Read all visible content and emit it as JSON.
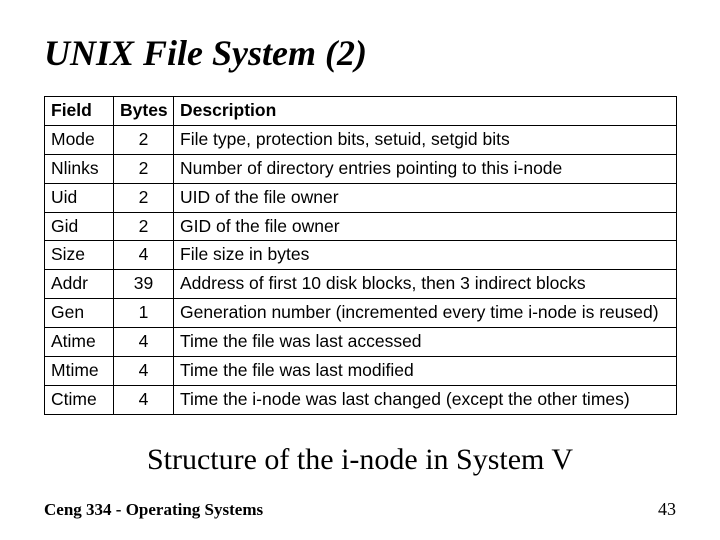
{
  "title": "UNIX File System (2)",
  "table": {
    "headers": {
      "field": "Field",
      "bytes": "Bytes",
      "desc": "Description"
    },
    "rows": [
      {
        "field": "Mode",
        "bytes": "2",
        "desc": "File type, protection bits, setuid, setgid bits"
      },
      {
        "field": "Nlinks",
        "bytes": "2",
        "desc": "Number of directory entries pointing to this i-node"
      },
      {
        "field": "Uid",
        "bytes": "2",
        "desc": "UID of the file owner"
      },
      {
        "field": "Gid",
        "bytes": "2",
        "desc": "GID of the file owner"
      },
      {
        "field": "Size",
        "bytes": "4",
        "desc": "File size in bytes"
      },
      {
        "field": "Addr",
        "bytes": "39",
        "desc": "Address of first 10 disk blocks, then 3 indirect blocks"
      },
      {
        "field": "Gen",
        "bytes": "1",
        "desc": "Generation number (incremented every time i-node is reused)"
      },
      {
        "field": "Atime",
        "bytes": "4",
        "desc": "Time the file was last accessed"
      },
      {
        "field": "Mtime",
        "bytes": "4",
        "desc": "Time the file was last modified"
      },
      {
        "field": "Ctime",
        "bytes": "4",
        "desc": "Time the i-node was last changed (except the other times)"
      }
    ]
  },
  "caption": "Structure of the i-node in System V",
  "footer": {
    "course": "Ceng 334 - Operating Systems",
    "page": "43"
  }
}
